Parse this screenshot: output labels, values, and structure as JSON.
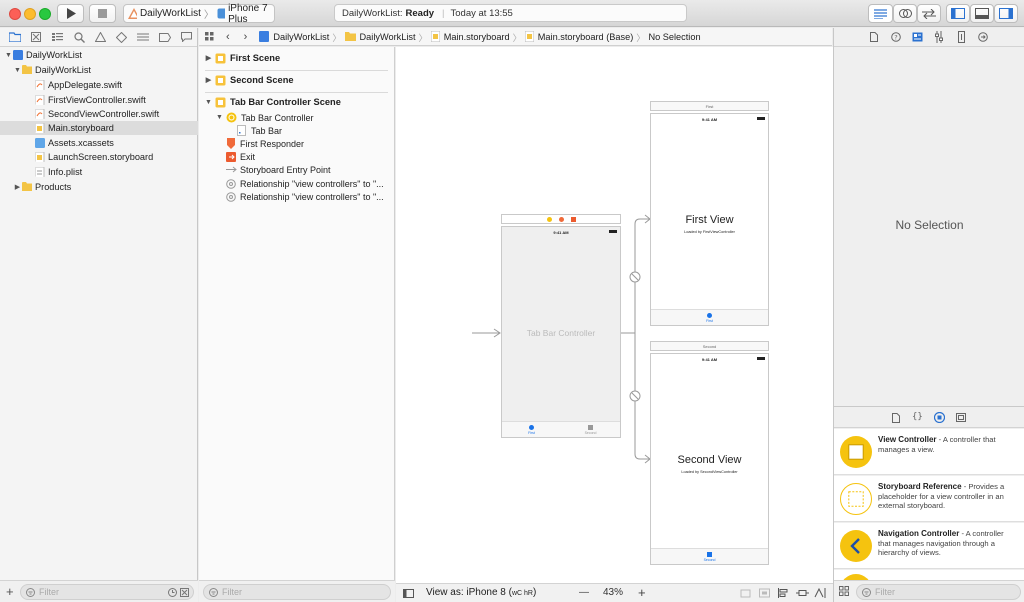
{
  "toolbar": {
    "scheme_target": "DailyWorkList",
    "device": "iPhone 7 Plus",
    "activity_status_app": "DailyWorkList:",
    "activity_status_state": "Ready",
    "activity_time": "Today at 13:55"
  },
  "navigator": {
    "project": "DailyWorkList",
    "group": "DailyWorkList",
    "files": [
      "AppDelegate.swift",
      "FirstViewController.swift",
      "SecondViewController.swift",
      "Main.storyboard",
      "Assets.xcassets",
      "LaunchScreen.storyboard",
      "Info.plist"
    ],
    "products": "Products",
    "filter_placeholder": "Filter",
    "add_symbol": "+"
  },
  "jumpbar": {
    "items": [
      "DailyWorkList",
      "DailyWorkList",
      "Main.storyboard",
      "Main.storyboard (Base)",
      "No Selection"
    ]
  },
  "outline": {
    "scene1": "First Scene",
    "scene2": "Second Scene",
    "scene3": "Tab Bar Controller Scene",
    "tbc": "Tab Bar Controller",
    "tabbar": "Tab Bar",
    "responder": "First Responder",
    "exit": "Exit",
    "entry": "Storyboard Entry Point",
    "rel1": "Relationship \"view controllers\" to \"...",
    "rel2": "Relationship \"view controllers\" to \"...",
    "filter_placeholder": "Filter"
  },
  "canvas": {
    "tbc_label": "Tab Bar Controller",
    "status_time": "9:41 AM",
    "tab_first": "First",
    "tab_second": "Second",
    "first_header": "First",
    "first_title": "First View",
    "first_subtitle": "Loaded by FirstViewController",
    "second_header": "Second",
    "second_title": "Second View",
    "second_subtitle": "Loaded by SecondViewController",
    "view_as": "View as: iPhone 8 (",
    "size_class": "wC hR",
    "view_as_close": ")",
    "zoom_minus": "—",
    "zoom": "43%",
    "zoom_plus": "+"
  },
  "inspector": {
    "no_selection": "No Selection",
    "filter_placeholder": "Filter",
    "library": [
      {
        "name": "View Controller",
        "desc": " - A controller that manages a view."
      },
      {
        "name": "Storyboard Reference",
        "desc": " - Provides a placeholder for a view controller in an external storyboard."
      },
      {
        "name": "Navigation Controller",
        "desc": " - A controller that manages navigation through a hierarchy of views."
      }
    ]
  },
  "colors": {
    "accent": "#1a73e8",
    "library_icon": "#f5c30f",
    "selection": "#dcdcdc"
  }
}
